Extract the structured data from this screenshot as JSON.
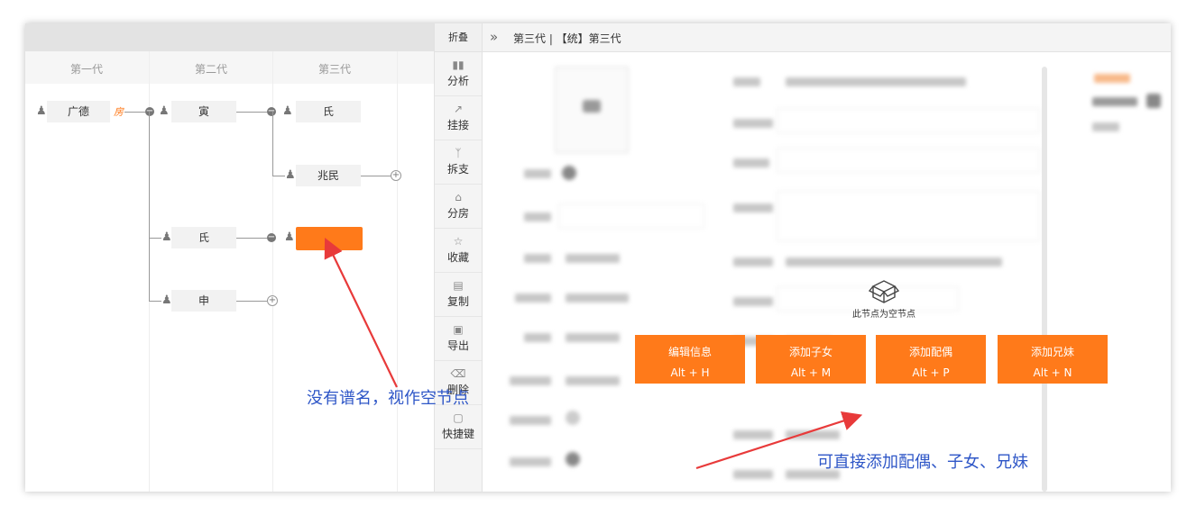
{
  "tree": {
    "generations": [
      "第一代",
      "第二代",
      "第三代"
    ],
    "nodes": {
      "gen1": "广德",
      "fang_badge": "房",
      "gen2_a": "寅",
      "gen2_b": "氏",
      "gen2_c": "申",
      "gen3_a": "氏",
      "gen3_b": "兆民"
    }
  },
  "toolbar": {
    "fold_label": "折叠",
    "items": [
      {
        "icon": "bar-chart-icon",
        "label": "分析"
      },
      {
        "icon": "trend-line-icon",
        "label": "挂接"
      },
      {
        "icon": "branch-icon",
        "label": "拆支"
      },
      {
        "icon": "house-icon",
        "label": "分房"
      },
      {
        "icon": "star-icon",
        "label": "收藏"
      },
      {
        "icon": "copy-icon",
        "label": "复制"
      },
      {
        "icon": "export-icon",
        "label": "导出"
      },
      {
        "icon": "delete-icon",
        "label": "删除"
      },
      {
        "icon": "shortcut-icon",
        "label": "快捷键"
      }
    ]
  },
  "header": {
    "breadcrumb": "第三代 | 【统】第三代"
  },
  "empty_notice": "此节点为空节点",
  "actions": [
    {
      "label": "编辑信息",
      "shortcut": "Alt + H"
    },
    {
      "label": "添加子女",
      "shortcut": "Alt + M"
    },
    {
      "label": "添加配偶",
      "shortcut": "Alt + P"
    },
    {
      "label": "添加兄妹",
      "shortcut": "Alt + N"
    }
  ],
  "annotations": {
    "left": "没有谱名，视作空节点",
    "right": "可直接添加配偶、子女、兄妹"
  },
  "colors": {
    "accent": "#ff7a1a",
    "annotation": "#2e56c7",
    "arrow": "#e83a3a"
  }
}
